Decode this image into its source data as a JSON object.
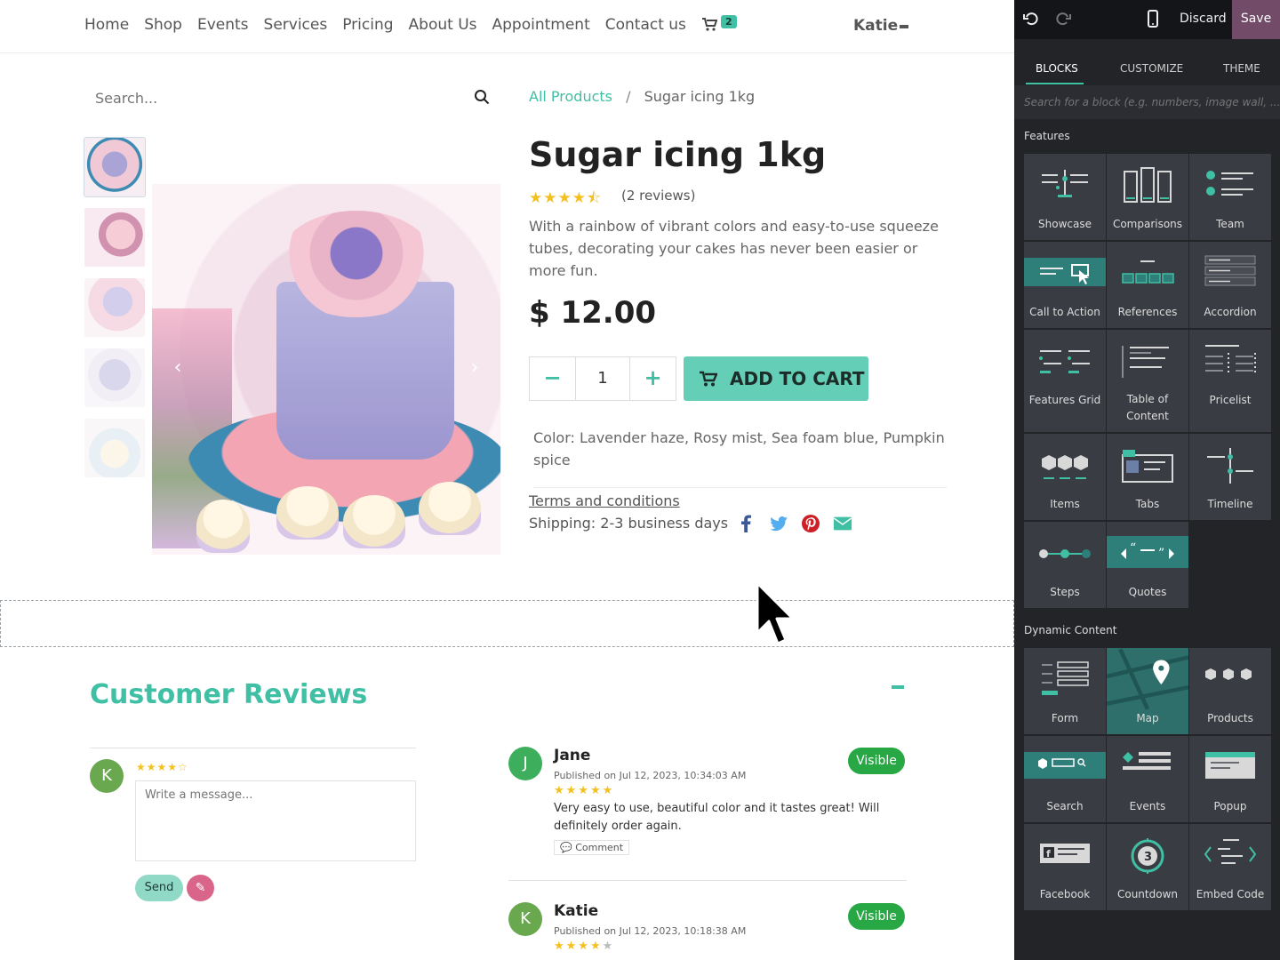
{
  "nav": {
    "items": [
      "Home",
      "Shop",
      "Events",
      "Services",
      "Pricing",
      "About Us",
      "Appointment",
      "Contact us"
    ],
    "cart_count": "2",
    "user": "Katie"
  },
  "search": {
    "placeholder": "Search..."
  },
  "breadcrumb": {
    "link": "All Products",
    "separator": "/",
    "current": "Sugar icing 1kg"
  },
  "product": {
    "title": "Sugar icing 1kg",
    "rating_stars": "★★★★⯪",
    "rating": 4.5,
    "reviews_count": "(2 reviews)",
    "description": "With a rainbow of vibrant colors and easy-to-use squeeze tubes, decorating your cakes has never been easier or more fun.",
    "price": "$ 12.00",
    "quantity": "1",
    "qty_minus": "−",
    "qty_plus": "+",
    "add_to_cart": "ADD TO CART",
    "attributes": "Color: Lavender haze, Rosy mist, Sea foam blue, Pumpkin spice",
    "terms": "Terms and conditions",
    "shipping": "Shipping: 2-3 business days",
    "carousel_prev": "‹",
    "carousel_next": "›"
  },
  "colors": {
    "accent": "#3fbfa3",
    "add_to_cart_bg": "#64cfb6",
    "visible_badge": "#28a745",
    "save_button": "#714b67",
    "star": "#f3c020"
  },
  "reviews": {
    "title": "Customer Reviews",
    "composer": {
      "avatar_letter": "K",
      "stars": "★★★★☆",
      "rating": 4,
      "placeholder": "Write a message...",
      "send": "Send",
      "attach_icon": "paperclip-icon",
      "attach_glyph": "✎"
    },
    "items": [
      {
        "avatar_letter": "J",
        "avatar_color": "#3cae5c",
        "name": "Jane",
        "date": "Published on Jul 12, 2023, 10:34:03 AM",
        "stars": "★★★★★",
        "rating": 5,
        "text": "Very easy to use, beautiful color and it tastes great! Will definitely order again.",
        "comment": "💬 Comment",
        "status": "Visible"
      },
      {
        "avatar_letter": "K",
        "avatar_color": "#6aa84f",
        "name": "Katie",
        "date": "Published on Jul 12, 2023, 10:18:38 AM",
        "stars": "★★★★",
        "rating": 4,
        "status": "Visible"
      }
    ]
  },
  "editor": {
    "discard": "Discard",
    "save": "Save",
    "tabs": [
      "BLOCKS",
      "CUSTOMIZE",
      "THEME"
    ],
    "active_tab": "BLOCKS",
    "search_placeholder": "Search for a block (e.g. numbers, image wall, ...)",
    "sections": [
      {
        "title": "Features",
        "blocks": [
          "Showcase",
          "Comparisons",
          "Team",
          "Call to Action",
          "References",
          "Accordion",
          "Features Grid",
          "Table of Content",
          "Pricelist",
          "Items",
          "Tabs",
          "Timeline",
          "Steps",
          "Quotes"
        ]
      },
      {
        "title": "Dynamic Content",
        "blocks": [
          "Form",
          "Map",
          "Products",
          "Search",
          "Events",
          "Popup",
          "Facebook",
          "Countdown",
          "Embed Code"
        ]
      }
    ]
  }
}
